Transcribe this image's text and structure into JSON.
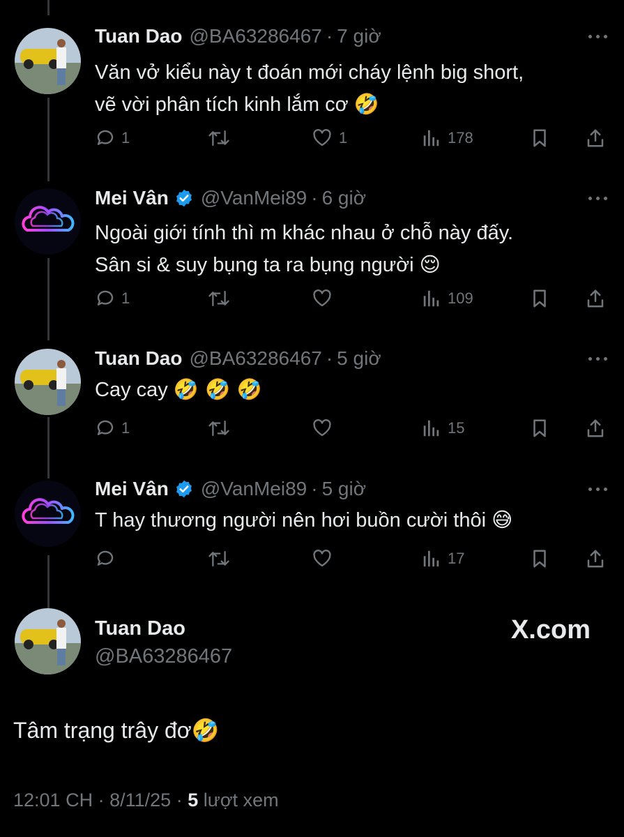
{
  "replies": [
    {
      "name": "Tuan Dao",
      "handle": "@BA63286467",
      "sep": "·",
      "time": "7 giờ",
      "line1": "Văn vở kiểu này t đoán mới cháy lệnh big short,",
      "line2": "vẽ vời phân tích kinh lắm cơ",
      "emoji": "🤣",
      "replies_count": "1",
      "retweets_count": "",
      "likes_count": "1",
      "views_count": "178"
    },
    {
      "name": "Mei Vân",
      "handle": "@VanMei89",
      "sep": "·",
      "time": "6 giờ",
      "line1": "Ngoài giới tính thì m khác nhau ở chỗ này đấy.",
      "line2": "Sân si & suy bụng ta ra bụng người",
      "emoji": "😌",
      "replies_count": "1",
      "retweets_count": "",
      "likes_count": "",
      "views_count": "109"
    },
    {
      "name": "Tuan Dao",
      "handle": "@BA63286467",
      "sep": "·",
      "time": "5 giờ",
      "line1": "Cay cay",
      "emoji": "🤣 🤣 🤣",
      "replies_count": "1",
      "retweets_count": "",
      "likes_count": "",
      "views_count": "15"
    },
    {
      "name": "Mei Vân",
      "handle": "@VanMei89",
      "sep": "·",
      "time": "5 giờ",
      "line1": "T hay thương người nên hơi buồn cười thôi",
      "emoji": "😅",
      "replies_count": "",
      "retweets_count": "",
      "likes_count": "",
      "views_count": "17"
    }
  ],
  "main": {
    "name": "Tuan Dao",
    "handle": "@BA63286467",
    "site": "X.com",
    "text": "Tâm trạng trây đơ",
    "emoji": "🤣",
    "time": "12:01 CH",
    "sep": "·",
    "date": "8/11/25",
    "views": "5",
    "views_label": "lượt xem"
  },
  "icons": {
    "reply": "reply-icon",
    "retweet": "retweet-icon",
    "like": "like-icon",
    "views": "views-icon",
    "bookmark": "bookmark-icon",
    "share": "share-icon",
    "verified": "verified-badge-icon",
    "more": "more-icon"
  },
  "colors": {
    "background": "#000000",
    "text": "#e7e9ea",
    "muted": "#71767b",
    "verified": "#1d9bf0",
    "thread_line": "#333639"
  }
}
